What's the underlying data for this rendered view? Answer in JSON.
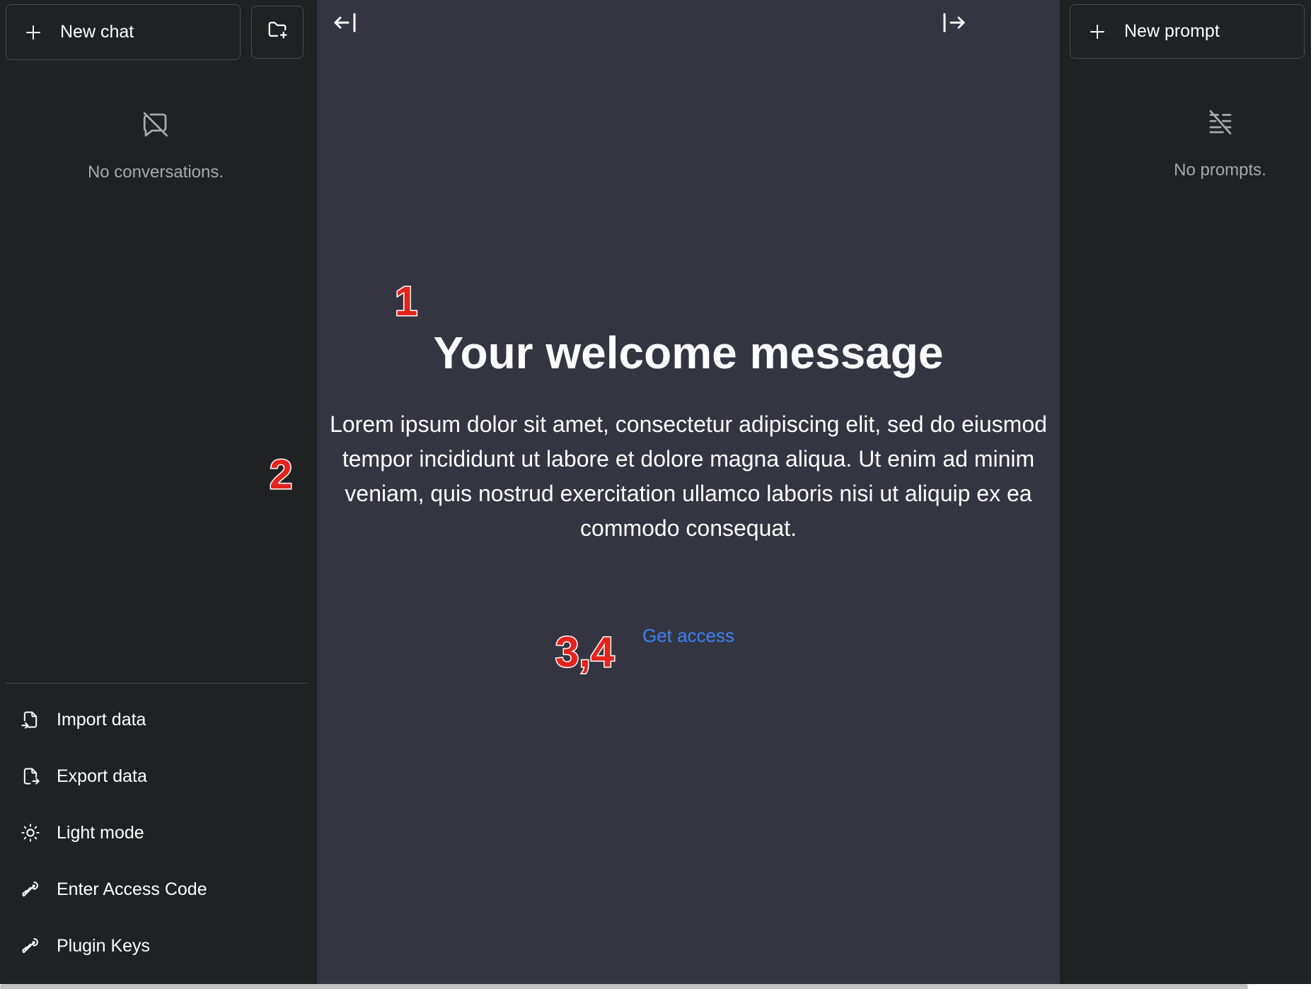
{
  "sidebar_left": {
    "new_chat_label": "New chat",
    "empty_text": "No conversations.",
    "menu": [
      {
        "label": "Import data",
        "icon": "file-import-icon"
      },
      {
        "label": "Export data",
        "icon": "file-export-icon"
      },
      {
        "label": "Light mode",
        "icon": "sun-icon"
      },
      {
        "label": "Enter Access Code",
        "icon": "key-icon"
      },
      {
        "label": "Plugin Keys",
        "icon": "key-icon"
      }
    ]
  },
  "main": {
    "title": "Your welcome message",
    "body": "Lorem ipsum dolor sit amet, consectetur adipiscing elit, sed do eiusmod tempor incididunt ut labore et dolore magna aliqua. Ut enim ad minim veniam, quis nostrud exercitation ullamco laboris nisi ut aliquip ex ea commodo consequat.",
    "link_label": "Get access"
  },
  "sidebar_right": {
    "new_prompt_label": "New prompt",
    "empty_text": "No prompts."
  },
  "annotations": {
    "a1": "1",
    "a2": "2",
    "a34": "3,4"
  },
  "colors": {
    "sidebar_bg": "#202123",
    "main_bg": "#343541",
    "link": "#3b82f6",
    "annotation": "#e5231d"
  }
}
